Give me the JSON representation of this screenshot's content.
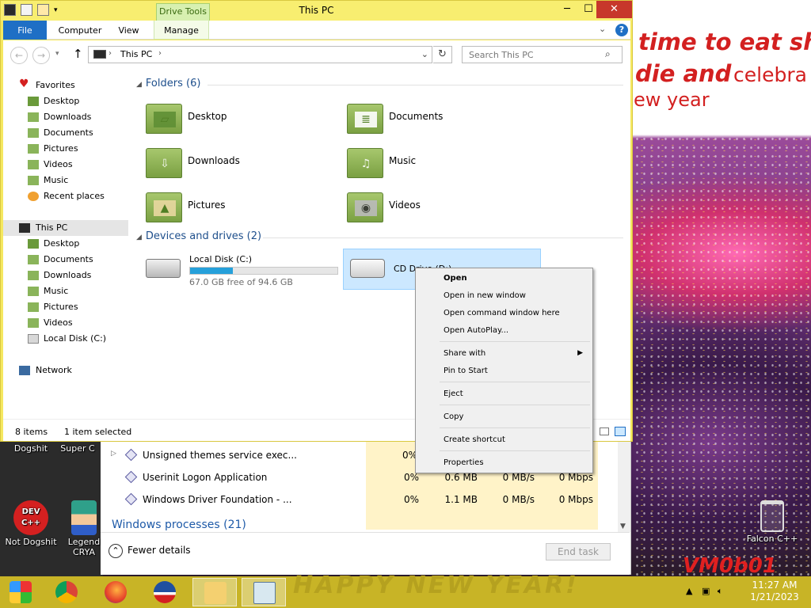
{
  "wallpaper": {
    "text_line1": "time to eat shit",
    "text_line2a": "die and",
    "text_line2b": "celebra",
    "text_line3": "ew year",
    "signature": "VM0b01",
    "bottom_text": "HAPPY NEW YEAR!"
  },
  "desktop_icons": [
    {
      "label": "Dogshit",
      "icon": "app-icon"
    },
    {
      "label": "Super C",
      "icon": "app-icon"
    },
    {
      "label": "Not Dogshit",
      "icon": "dev-cpp-icon",
      "badge": "DEV C++"
    },
    {
      "label": "Legend CRYA",
      "icon": "character-icon"
    },
    {
      "label": "Falcon C++",
      "icon": "recycle-bin-icon"
    }
  ],
  "taskmgr": {
    "rows": [
      {
        "name": "Unsigned themes service exec...",
        "cpu": "0%",
        "mem": "",
        "disk": "",
        "net": ""
      },
      {
        "name": "Userinit Logon Application",
        "cpu": "0%",
        "mem": "0.6 MB",
        "disk": "0 MB/s",
        "net": "0 Mbps"
      },
      {
        "name": "Windows Driver Foundation - ...",
        "cpu": "0%",
        "mem": "1.1 MB",
        "disk": "0 MB/s",
        "net": "0 Mbps"
      }
    ],
    "section": "Windows processes (21)",
    "fewer_details": "Fewer details",
    "end_task": "End task"
  },
  "explorer": {
    "title": "This PC",
    "contextual_tab": "Drive Tools",
    "ribbon_tabs": {
      "file": "File",
      "computer": "Computer",
      "view": "View",
      "manage": "Manage"
    },
    "address": "This PC",
    "search_placeholder": "Search This PC",
    "nav": {
      "favorites": "Favorites",
      "fav_items": [
        "Desktop",
        "Downloads",
        "Documents",
        "Pictures",
        "Videos",
        "Music",
        "Recent places"
      ],
      "this_pc": "This PC",
      "pc_items": [
        "Desktop",
        "Documents",
        "Downloads",
        "Music",
        "Pictures",
        "Videos",
        "Local Disk (C:)"
      ],
      "network": "Network"
    },
    "folders_header": "Folders (6)",
    "folders": [
      "Desktop",
      "Documents",
      "Downloads",
      "Music",
      "Pictures",
      "Videos"
    ],
    "devices_header": "Devices and drives (2)",
    "drives": [
      {
        "name": "Local Disk (C:)",
        "free": "67.0 GB free of 94.6 GB",
        "used_fraction": 0.29
      },
      {
        "name": "CD Drive (D:)"
      }
    ],
    "status": {
      "items": "8 items",
      "selected": "1 item selected"
    }
  },
  "context_menu": {
    "open": "Open",
    "open_new_window": "Open in new window",
    "open_cmd": "Open command window here",
    "open_autoplay": "Open AutoPlay...",
    "share_with": "Share with",
    "pin_start": "Pin to Start",
    "eject": "Eject",
    "copy": "Copy",
    "create_shortcut": "Create shortcut",
    "properties": "Properties"
  },
  "taskbar": {
    "time": "11:27 AM",
    "date": "1/21/2023"
  },
  "colors": {
    "window_frame": "#f5e860",
    "taskbar": "#c8b426",
    "accent": "#1f6fc5",
    "selection": "#cce8ff"
  }
}
